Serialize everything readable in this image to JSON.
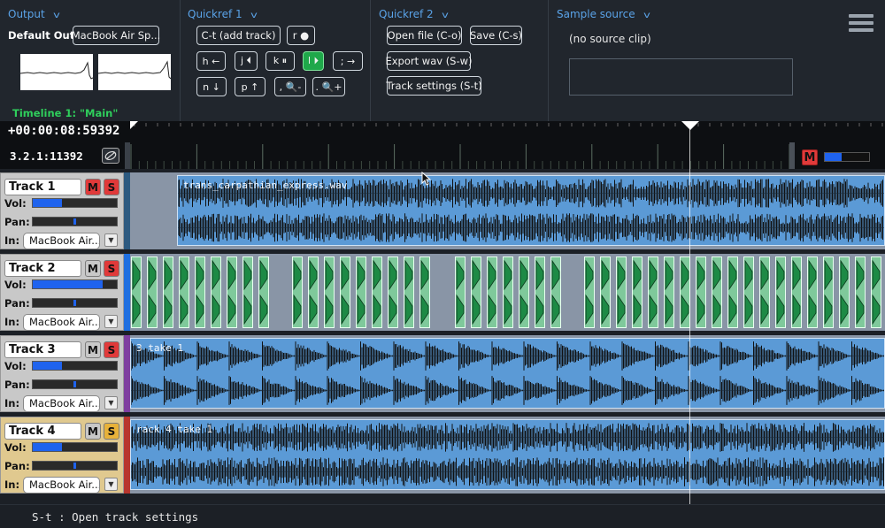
{
  "output": {
    "title": "Output",
    "default_out_label": "Default Out:",
    "device": "MacBook Air Sp...",
    "timeline_label": "Timeline 1: \"Main\""
  },
  "quickref1": {
    "title": "Quickref 1",
    "add_track": "C-t (add track)",
    "record": "r ●",
    "keys": [
      "h ←",
      "j ⏴",
      "k ⏸",
      "l ⏵",
      "; →",
      "n ↓",
      "p ↑",
      ", 🔍-",
      ". 🔍+"
    ]
  },
  "quickref2": {
    "title": "Quickref 2",
    "open_file": "Open file (C-o)",
    "save": "Save (C-s)",
    "export_wav": "Export wav (S-w)",
    "track_settings": "Track settings (S-t)"
  },
  "sample_source": {
    "title": "Sample source",
    "status": "(no source clip)"
  },
  "timeline": {
    "timecode": "+00:00:08:59392",
    "bar_beat": "3.2.1:11392",
    "master_label": "M",
    "master_level": 0.38
  },
  "tracks": [
    {
      "name": "Track 1",
      "mute": "M",
      "solo": "S",
      "vol_label": "Vol:",
      "pan_label": "Pan:",
      "in_label": "In:",
      "input": "MacBook Air...",
      "volume": 0.35,
      "pan": 0.5,
      "color": "#c8c8c8",
      "strip_color": "#2d5a80",
      "mute_on": true,
      "solo_on": true,
      "clip_name": "trans_carpathian_express.wav"
    },
    {
      "name": "Track 2",
      "mute": "M",
      "solo": "S",
      "vol_label": "Vol:",
      "pan_label": "Pan:",
      "in_label": "In:",
      "input": "MacBook Air...",
      "volume": 0.83,
      "pan": 0.5,
      "color": "#c8c8c8",
      "strip_color": "#1f6fe0",
      "mute_on": false,
      "solo_on": true,
      "clip_name": ""
    },
    {
      "name": "Track 3",
      "mute": "M",
      "solo": "S",
      "vol_label": "Vol:",
      "pan_label": "Pan:",
      "in_label": "In:",
      "input": "MacBook Air...",
      "volume": 0.35,
      "pan": 0.5,
      "color": "#c8c8c8",
      "strip_color": "#7f3fa0",
      "mute_on": false,
      "solo_on": true,
      "clip_name": "3 take 1"
    },
    {
      "name": "Track 4",
      "mute": "M",
      "solo": "S",
      "vol_label": "Vol:",
      "pan_label": "Pan:",
      "in_label": "In:",
      "input": "MacBook Air...",
      "volume": 0.35,
      "pan": 0.5,
      "color": "#e0c98f",
      "strip_color": "#b8362e",
      "mute_on": false,
      "solo_on": false,
      "clip_name": "rack 4 take 1"
    }
  ],
  "status": {
    "text": "S-t : Open track settings"
  }
}
